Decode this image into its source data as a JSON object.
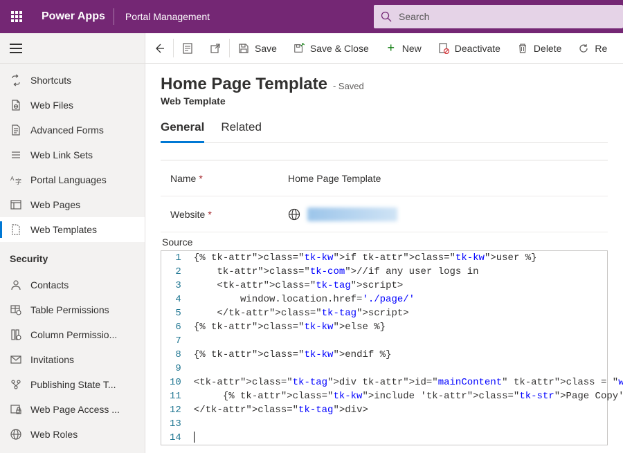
{
  "header": {
    "brand": "Power Apps",
    "portal": "Portal Management",
    "search_placeholder": "Search"
  },
  "sidebar": {
    "group1": [
      {
        "label": "Shortcuts",
        "icon": "shortcut"
      },
      {
        "label": "Web Files",
        "icon": "webfile"
      },
      {
        "label": "Advanced Forms",
        "icon": "form"
      },
      {
        "label": "Web Link Sets",
        "icon": "linkset"
      },
      {
        "label": "Portal Languages",
        "icon": "lang"
      },
      {
        "label": "Web Pages",
        "icon": "webpage"
      },
      {
        "label": "Web Templates",
        "icon": "template",
        "active": true
      }
    ],
    "section_security": "Security",
    "group2": [
      {
        "label": "Contacts",
        "icon": "contact"
      },
      {
        "label": "Table Permissions",
        "icon": "tableperm"
      },
      {
        "label": "Column Permissio...",
        "icon": "colperm"
      },
      {
        "label": "Invitations",
        "icon": "invite"
      },
      {
        "label": "Publishing State T...",
        "icon": "pubstate"
      },
      {
        "label": "Web Page Access ...",
        "icon": "access"
      },
      {
        "label": "Web Roles",
        "icon": "roles"
      }
    ]
  },
  "commands": {
    "back": "",
    "save": "Save",
    "save_close": "Save & Close",
    "new": "New",
    "deactivate": "Deactivate",
    "delete": "Delete",
    "refresh": "Re"
  },
  "record": {
    "title": "Home Page Template",
    "status": "- Saved",
    "entity": "Web Template",
    "tabs": {
      "general": "General",
      "related": "Related"
    },
    "fields": {
      "name_label": "Name",
      "name_value": "Home Page Template",
      "website_label": "Website",
      "source_label": "Source"
    },
    "code_lines": [
      "{% if user %}",
      "    //if any user logs in",
      "    <script>",
      "        window.location.href='./page/'",
      "    </script>",
      "{% else %}",
      "",
      "{% endif %}",
      "",
      "<div id=\"mainContent\" class = \"wrapper-body\" role=\"main\">",
      "     {% include 'Page Copy' %}",
      "</div>",
      "",
      ""
    ]
  }
}
